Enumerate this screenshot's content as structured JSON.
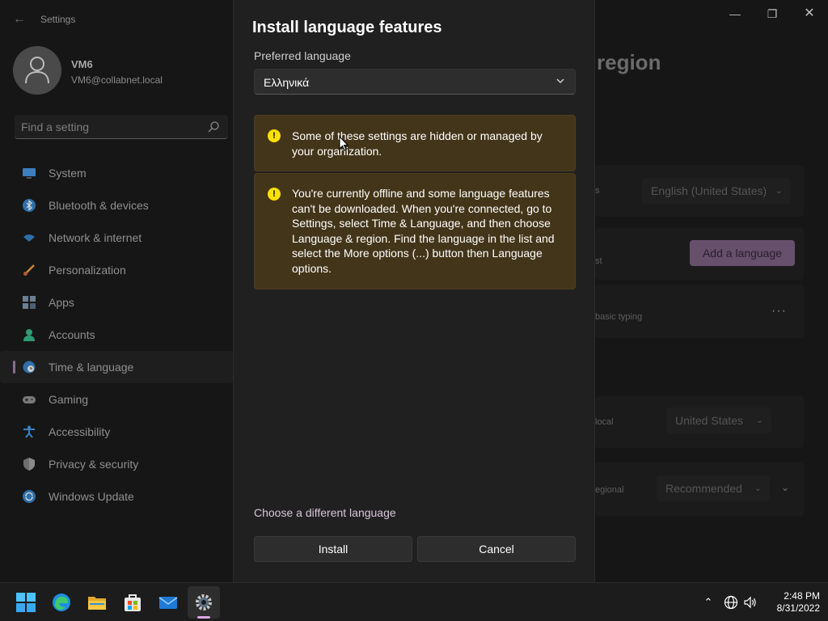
{
  "window": {
    "app_title": "Settings",
    "page_heading": "region"
  },
  "profile": {
    "name": "VM6",
    "email": "VM6@collabnet.local"
  },
  "search": {
    "placeholder": "Find a setting"
  },
  "sidebar": {
    "items": [
      {
        "label": "System",
        "icon": "monitor-icon",
        "color": "#3a8fd6"
      },
      {
        "label": "Bluetooth & devices",
        "icon": "bluetooth-icon",
        "color": "#3a8fd6"
      },
      {
        "label": "Network & internet",
        "icon": "wifi-icon",
        "color": "#2f86c9"
      },
      {
        "label": "Personalization",
        "icon": "brush-icon",
        "color": "#c9853a"
      },
      {
        "label": "Apps",
        "icon": "apps-icon",
        "color": "#6b8ba6"
      },
      {
        "label": "Accounts",
        "icon": "person-icon",
        "color": "#2fa37a"
      },
      {
        "label": "Time & language",
        "icon": "globe-clock-icon",
        "color": "#3a8fd6",
        "selected": true
      },
      {
        "label": "Gaming",
        "icon": "gamepad-icon",
        "color": "#8a8a8a"
      },
      {
        "label": "Accessibility",
        "icon": "accessibility-icon",
        "color": "#3a8fd6"
      },
      {
        "label": "Privacy & security",
        "icon": "shield-icon",
        "color": "#8a8a8a"
      },
      {
        "label": "Windows Update",
        "icon": "update-icon",
        "color": "#2f86c9"
      }
    ]
  },
  "background_content": {
    "display_language_value": "English (United States)",
    "add_language_label": "Add a language",
    "row_fragment_1": "s",
    "row_fragment_2": "st",
    "basic_typing": "basic typing",
    "region_label_fragment": "local",
    "region_value": "United States",
    "regional_label_fragment": "egional",
    "regional_format_value": "Recommended"
  },
  "dialog": {
    "title": "Install language features",
    "preferred_label": "Preferred language",
    "selected_language": "Ελληνικά",
    "warning_managed": "Some of these settings are hidden or managed by your organization.",
    "warning_offline": "You're currently offline and some language features can't be downloaded. When you're connected, go to Settings, select Time & Language, and then choose Language & region. Find the language in the list and select the More options (...) button then Language options.",
    "choose_link": "Choose a different language",
    "install_label": "Install",
    "cancel_label": "Cancel"
  },
  "taskbar": {
    "apps": [
      "start-icon",
      "edge-icon",
      "file-explorer-icon",
      "store-icon",
      "mail-icon",
      "settings-icon"
    ],
    "time": "2:48 PM",
    "date": "8/31/2022"
  },
  "colors": {
    "accent": "#d9a6e0",
    "warning_bg": "#433519",
    "warning_icon": "#fce100"
  }
}
